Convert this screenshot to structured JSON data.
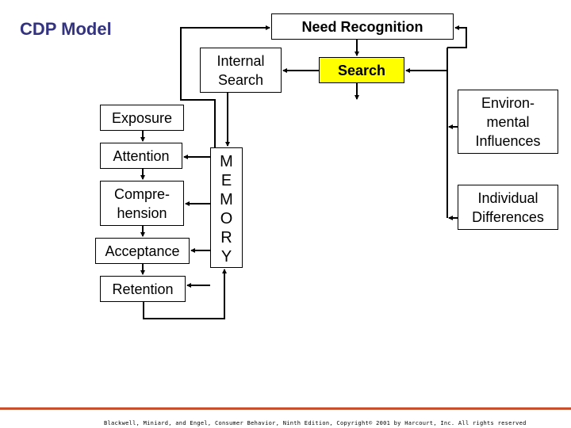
{
  "title": "CDP Model",
  "boxes": {
    "need_recognition": "Need Recognition",
    "internal_search": "Internal\nSearch",
    "search": "Search",
    "exposure": "Exposure",
    "attention": "Attention",
    "comprehension": "Compre-\nhension",
    "acceptance": "Acceptance",
    "retention": "Retention",
    "environmental_influences": "Environ-\nmental\nInfluences",
    "individual_differences": "Individual\nDifferences"
  },
  "memory_letters": [
    "M",
    "E",
    "M",
    "O",
    "R",
    "Y"
  ],
  "colors": {
    "title": "#333380",
    "search_fill": "#ffff00",
    "footer_rule": "#c8502e"
  },
  "footer": "Blackwell, Miniard, and Engel, Consumer Behavior, Ninth Edition, Copyright© 2001 by Harcourt, Inc. All rights reserved"
}
